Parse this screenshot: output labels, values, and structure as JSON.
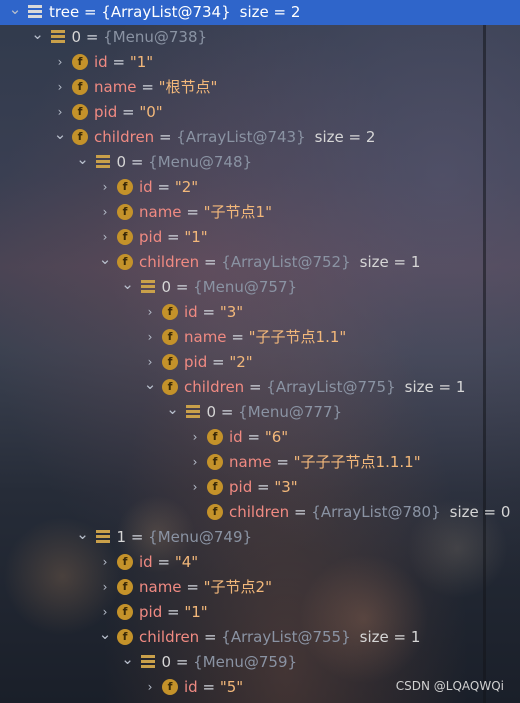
{
  "rows": [
    {
      "depth": 0,
      "arrow": "expanded",
      "icon": "list",
      "name": "tree",
      "kind": "obj",
      "eq": " = ",
      "value": "{ArrayList@734}",
      "vkind": "plain",
      "size": "size = 2",
      "selected": true
    },
    {
      "depth": 1,
      "arrow": "expanded",
      "icon": "list",
      "name": "0",
      "kind": "obj",
      "eq": " = ",
      "value": "{Menu@738}",
      "vkind": "ref"
    },
    {
      "depth": 2,
      "arrow": "collapsed",
      "icon": "field",
      "name": "id",
      "kind": "field",
      "eq": " = ",
      "value": "\"1\"",
      "vkind": "str"
    },
    {
      "depth": 2,
      "arrow": "collapsed",
      "icon": "field",
      "name": "name",
      "kind": "field",
      "eq": " = ",
      "value": "\"根节点\"",
      "vkind": "str"
    },
    {
      "depth": 2,
      "arrow": "collapsed",
      "icon": "field",
      "name": "pid",
      "kind": "field",
      "eq": " = ",
      "value": "\"0\"",
      "vkind": "str"
    },
    {
      "depth": 2,
      "arrow": "expanded",
      "icon": "field",
      "name": "children",
      "kind": "field",
      "eq": " = ",
      "value": "{ArrayList@743}",
      "vkind": "ref",
      "size": "size = 2"
    },
    {
      "depth": 3,
      "arrow": "expanded",
      "icon": "list",
      "name": "0",
      "kind": "obj",
      "eq": " = ",
      "value": "{Menu@748}",
      "vkind": "ref"
    },
    {
      "depth": 4,
      "arrow": "collapsed",
      "icon": "field",
      "name": "id",
      "kind": "field",
      "eq": " = ",
      "value": "\"2\"",
      "vkind": "str"
    },
    {
      "depth": 4,
      "arrow": "collapsed",
      "icon": "field",
      "name": "name",
      "kind": "field",
      "eq": " = ",
      "value": "\"子节点1\"",
      "vkind": "str"
    },
    {
      "depth": 4,
      "arrow": "collapsed",
      "icon": "field",
      "name": "pid",
      "kind": "field",
      "eq": " = ",
      "value": "\"1\"",
      "vkind": "str"
    },
    {
      "depth": 4,
      "arrow": "expanded",
      "icon": "field",
      "name": "children",
      "kind": "field",
      "eq": " = ",
      "value": "{ArrayList@752}",
      "vkind": "ref",
      "size": "size = 1"
    },
    {
      "depth": 5,
      "arrow": "expanded",
      "icon": "list",
      "name": "0",
      "kind": "obj",
      "eq": " = ",
      "value": "{Menu@757}",
      "vkind": "ref"
    },
    {
      "depth": 6,
      "arrow": "collapsed",
      "icon": "field",
      "name": "id",
      "kind": "field",
      "eq": " = ",
      "value": "\"3\"",
      "vkind": "str"
    },
    {
      "depth": 6,
      "arrow": "collapsed",
      "icon": "field",
      "name": "name",
      "kind": "field",
      "eq": " = ",
      "value": "\"子子节点1.1\"",
      "vkind": "str"
    },
    {
      "depth": 6,
      "arrow": "collapsed",
      "icon": "field",
      "name": "pid",
      "kind": "field",
      "eq": " = ",
      "value": "\"2\"",
      "vkind": "str"
    },
    {
      "depth": 6,
      "arrow": "expanded",
      "icon": "field",
      "name": "children",
      "kind": "field",
      "eq": " = ",
      "value": "{ArrayList@775}",
      "vkind": "ref",
      "size": "size = 1"
    },
    {
      "depth": 7,
      "arrow": "expanded",
      "icon": "list",
      "name": "0",
      "kind": "obj",
      "eq": " = ",
      "value": "{Menu@777}",
      "vkind": "ref"
    },
    {
      "depth": 8,
      "arrow": "collapsed",
      "icon": "field",
      "name": "id",
      "kind": "field",
      "eq": " = ",
      "value": "\"6\"",
      "vkind": "str"
    },
    {
      "depth": 8,
      "arrow": "collapsed",
      "icon": "field",
      "name": "name",
      "kind": "field",
      "eq": " = ",
      "value": "\"子子子节点1.1.1\"",
      "vkind": "str"
    },
    {
      "depth": 8,
      "arrow": "collapsed",
      "icon": "field",
      "name": "pid",
      "kind": "field",
      "eq": " = ",
      "value": "\"3\"",
      "vkind": "str"
    },
    {
      "depth": 8,
      "arrow": "none",
      "icon": "field",
      "name": "children",
      "kind": "field",
      "eq": " = ",
      "value": "{ArrayList@780}",
      "vkind": "ref",
      "size": "size = 0"
    },
    {
      "depth": 3,
      "arrow": "expanded",
      "icon": "list",
      "name": "1",
      "kind": "obj",
      "eq": " = ",
      "value": "{Menu@749}",
      "vkind": "ref"
    },
    {
      "depth": 4,
      "arrow": "collapsed",
      "icon": "field",
      "name": "id",
      "kind": "field",
      "eq": " = ",
      "value": "\"4\"",
      "vkind": "str"
    },
    {
      "depth": 4,
      "arrow": "collapsed",
      "icon": "field",
      "name": "name",
      "kind": "field",
      "eq": " = ",
      "value": "\"子节点2\"",
      "vkind": "str"
    },
    {
      "depth": 4,
      "arrow": "collapsed",
      "icon": "field",
      "name": "pid",
      "kind": "field",
      "eq": " = ",
      "value": "\"1\"",
      "vkind": "str"
    },
    {
      "depth": 4,
      "arrow": "expanded",
      "icon": "field",
      "name": "children",
      "kind": "field",
      "eq": " = ",
      "value": "{ArrayList@755}",
      "vkind": "ref",
      "size": "size = 1"
    },
    {
      "depth": 5,
      "arrow": "expanded",
      "icon": "list",
      "name": "0",
      "kind": "obj",
      "eq": " = ",
      "value": "{Menu@759}",
      "vkind": "ref"
    },
    {
      "depth": 6,
      "arrow": "collapsed",
      "icon": "field",
      "name": "id",
      "kind": "field",
      "eq": " = ",
      "value": "\"5\"",
      "vkind": "str"
    }
  ],
  "icons": {
    "field_glyph": "f",
    "expanded_glyph": "⌄",
    "collapsed_glyph": "›"
  },
  "colors": {
    "selection": "#2f65ca",
    "field_name": "#f08a82",
    "string_value": "#f3b87a",
    "ref_value": "#8a93a3",
    "field_icon": "#c4922a"
  },
  "watermark": "CSDN @LQAQWQi"
}
